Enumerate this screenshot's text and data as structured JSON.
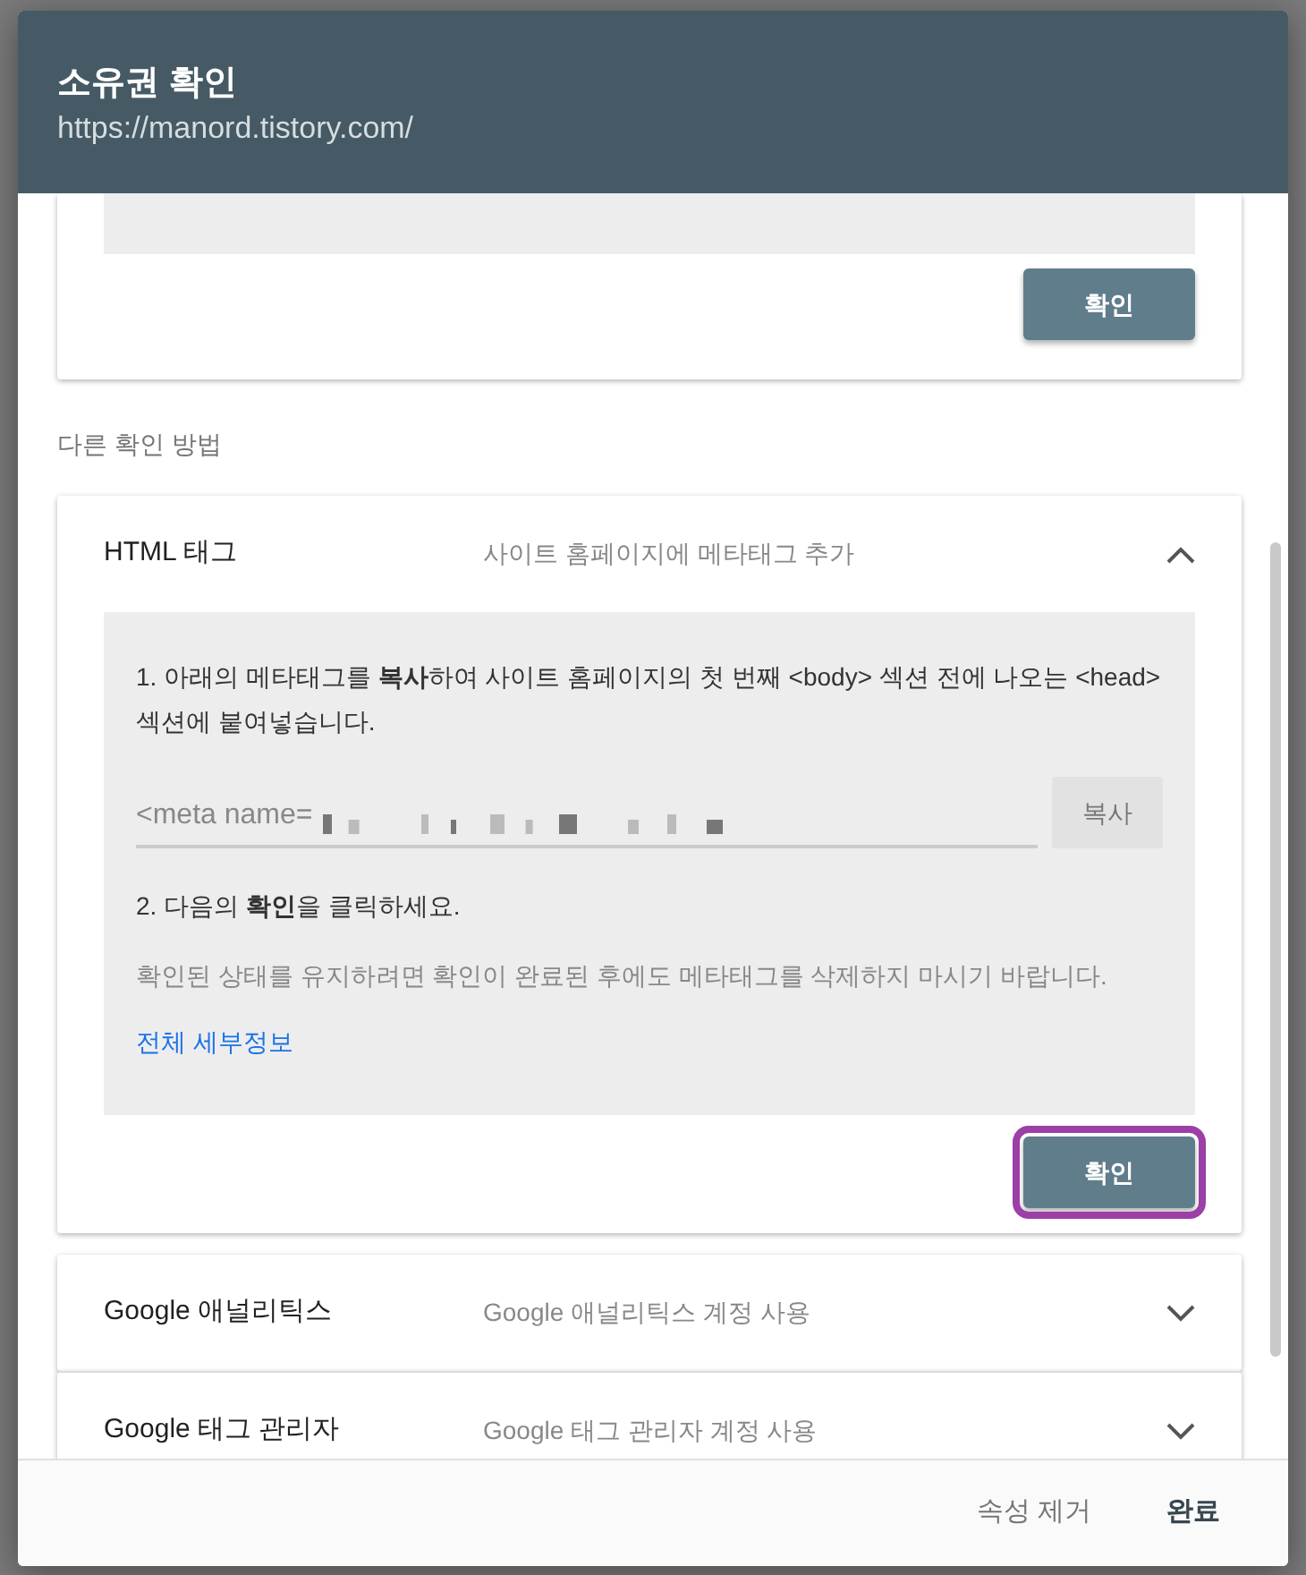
{
  "dialog": {
    "title": "소유권 확인",
    "url": "https://manord.tistory.com/"
  },
  "top_card": {
    "button": "확인"
  },
  "section_label": "다른 확인 방법",
  "methods": [
    {
      "name": "HTML 태그",
      "description": "사이트 홈페이지에 메타태그 추가",
      "expanded": true,
      "details": {
        "step1": "1. 아래의 메타태그를 **복사**하여 사이트 홈페이지의 첫 번째 <body> 섹션 전에 나오는 <head> 섹션에 붙여넣습니다.",
        "meta_value": "<meta name=",
        "copy_button": "복사",
        "step2": "2. 다음의 **확인**을 클릭하세요.",
        "note": "확인된 상태를 유지하려면 확인이 완료된 후에도 메타태그를 삭제하지 마시기 바랍니다.",
        "link": "전체 세부정보",
        "button": "확인",
        "button_highlighted": true
      }
    },
    {
      "name": "Google 애널리틱스",
      "description": "Google 애널리틱스 계정 사용",
      "expanded": false
    },
    {
      "name": "Google 태그 관리자",
      "description": "Google 태그 관리자 계정 사용",
      "expanded": false
    }
  ],
  "footer": {
    "buttons": [
      {
        "label": "속성 제거",
        "primary": false
      },
      {
        "label": "완료",
        "primary": true
      }
    ]
  }
}
